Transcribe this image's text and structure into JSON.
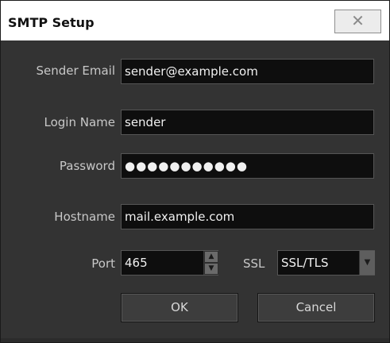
{
  "dialog": {
    "title": "SMTP Setup",
    "close_glyph": "✕"
  },
  "form": {
    "sender_email": {
      "label": "Sender Email",
      "value": "sender@example.com"
    },
    "login_name": {
      "label": "Login Name",
      "value": "sender"
    },
    "password": {
      "label": "Password",
      "value": "●●●●●●●●●●●"
    },
    "hostname": {
      "label": "Hostname",
      "value": "mail.example.com"
    },
    "port": {
      "label": "Port",
      "value": "465",
      "up_glyph": "▲",
      "down_glyph": "▼"
    },
    "ssl": {
      "label": "SSL",
      "value": "SSL/TLS",
      "arrow_glyph": "▼"
    }
  },
  "buttons": {
    "ok_label": "OK",
    "cancel_label": "Cancel"
  },
  "colors": {
    "window_bg": "#333333",
    "field_bg": "#0e0e0e",
    "label_text": "#c8c8c8"
  }
}
